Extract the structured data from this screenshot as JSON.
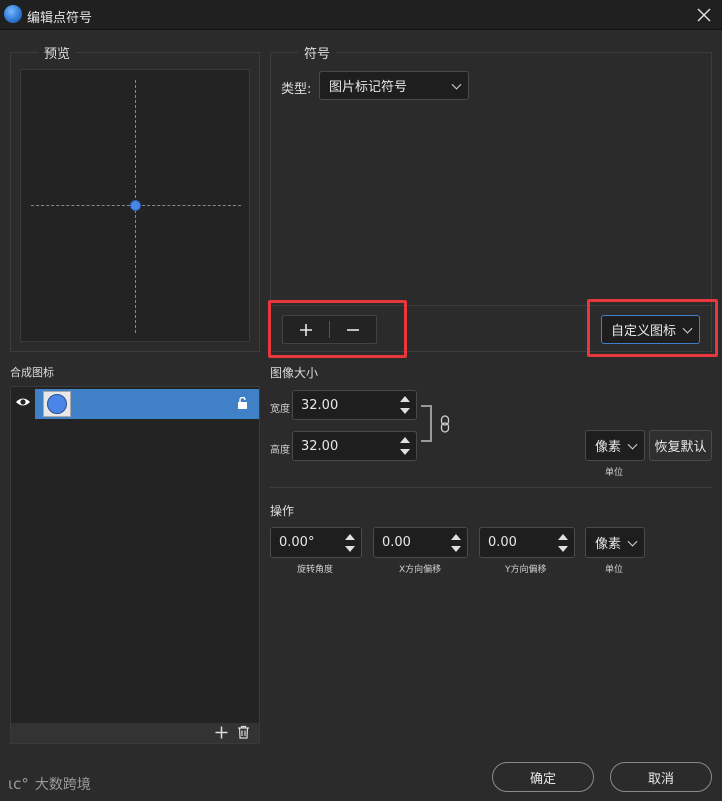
{
  "window": {
    "title": "编辑点符号"
  },
  "preview": {
    "title": "预览"
  },
  "symbol": {
    "title": "符号",
    "type_label": "类型:",
    "type_value": "图片标记符号",
    "custom_icon": "自定义图标"
  },
  "composite": {
    "title": "合成图标"
  },
  "image_size": {
    "title": "图像大小",
    "width_label": "宽度",
    "width_value": "32.00",
    "height_label": "高度",
    "height_value": "32.00",
    "unit_value": "像素",
    "unit_label": "单位",
    "reset_label": "恢复默认"
  },
  "operation": {
    "title": "操作",
    "rotation_value": "0.00°",
    "rotation_label": "旋转角度",
    "x_offset_value": "0.00",
    "x_offset_label": "X方向偏移",
    "y_offset_value": "0.00",
    "y_offset_label": "Y方向偏移",
    "unit_value": "像素",
    "unit_label": "单位"
  },
  "buttons": {
    "ok": "确定",
    "cancel": "取消"
  },
  "watermark": {
    "text": "大数跨境"
  },
  "colors": {
    "accent": "#3f80c6",
    "highlight": "#e8363d",
    "background": "#2b2b2b"
  }
}
